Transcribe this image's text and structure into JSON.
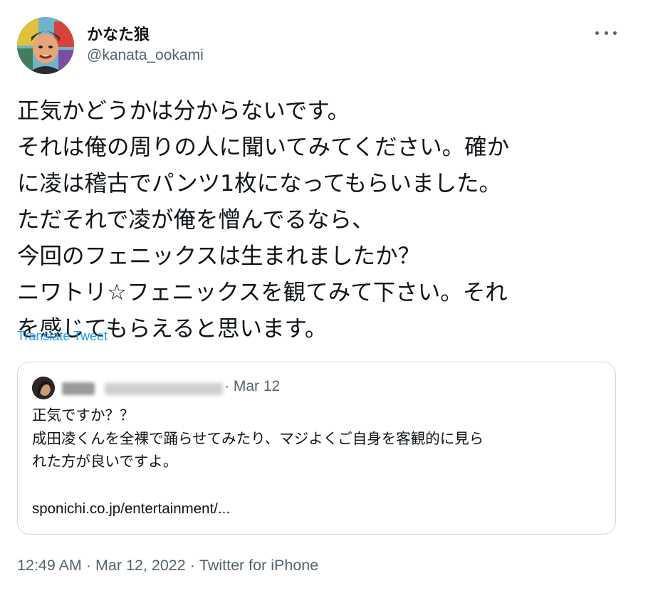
{
  "author": {
    "display_name": "かなた狼",
    "handle": "@kanata_ookami",
    "avatar_icon": "avatar-illustration-icon"
  },
  "more_icon": "more-options-icon",
  "tweet": {
    "lines": [
      "正気かどうかは分からないです。",
      "それは俺の周りの人に聞いてみてください。確か",
      "に凌は稽古でパンツ1枚になってもらいました。",
      "ただそれで凌が俺を憎んでるなら、",
      "今回のフェニックスは生まれましたか？",
      "ニワトリ☆フェニックスを観てみて下さい。それ",
      "を感じてもらえると思います。"
    ],
    "translate_label": "Translate Tweet"
  },
  "quoted_tweet": {
    "date": "· Mar 12",
    "lines": [
      "正気ですか？？",
      "成田凌くんを全裸で踊らせてみたり、マジよくご自身を客観的に見ら",
      "れた方が良いですよ。"
    ],
    "link_text": "sponichi.co.jp/entertainment/..."
  },
  "meta": {
    "time": "12:49 AM",
    "date": "Mar 12, 2022",
    "source": "Twitter for iPhone",
    "separator": "·"
  },
  "colors": {
    "accent": "#1d9bf0",
    "text_primary": "#0f1419",
    "text_secondary": "#536471",
    "border": "#cfd9de"
  }
}
